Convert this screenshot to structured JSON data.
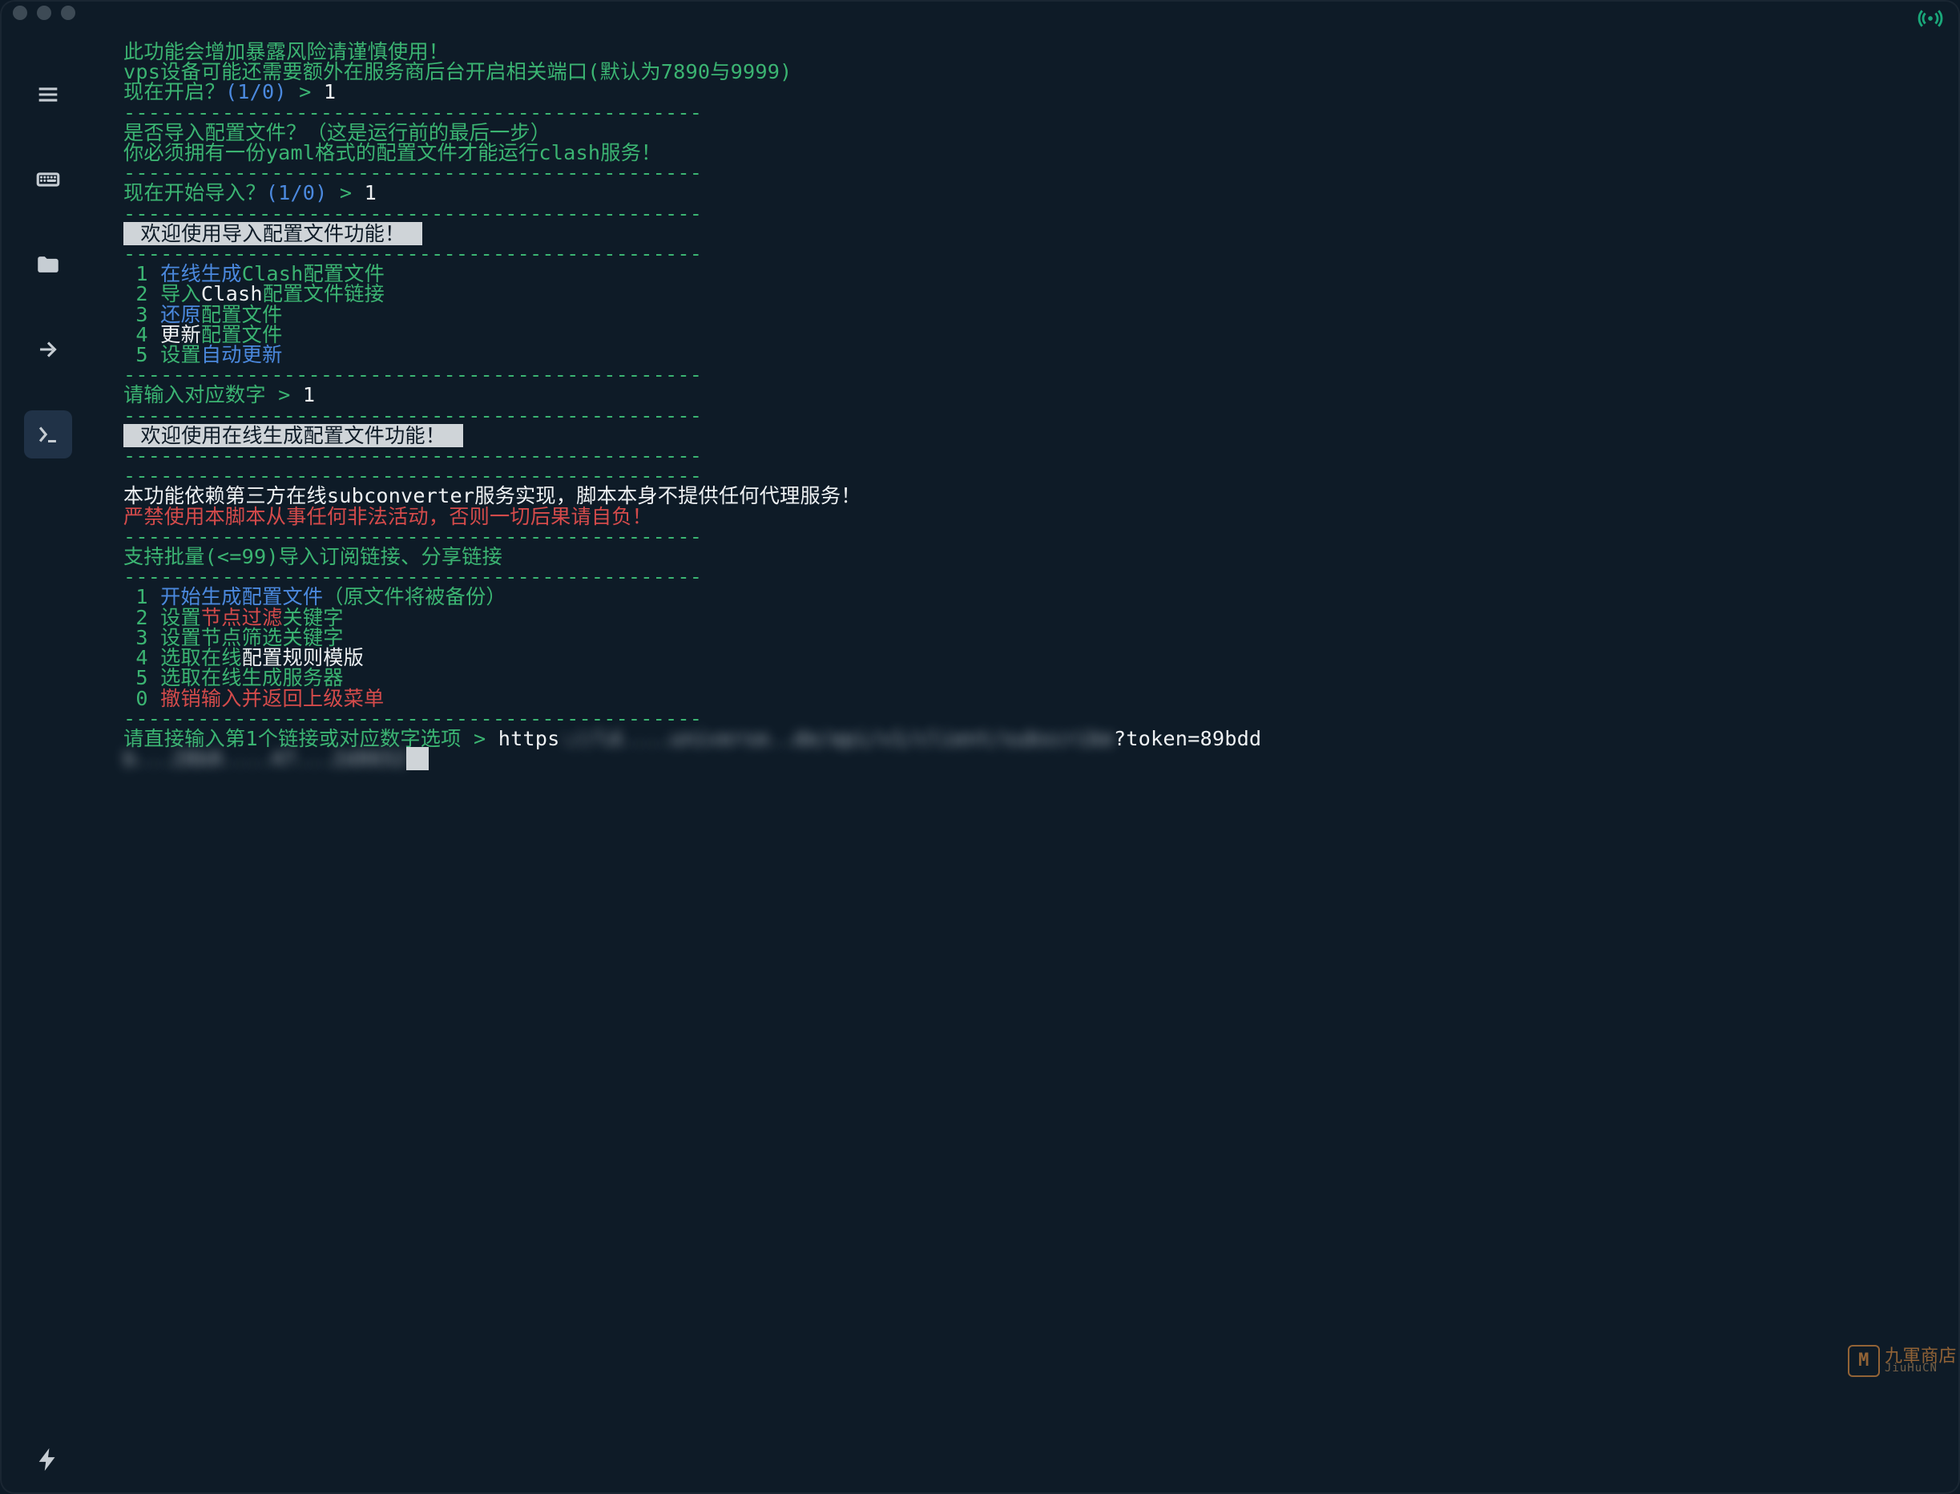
{
  "colors": {
    "bg": "#0e1b27",
    "green": "#3bb472",
    "blue": "#4b89de",
    "red": "#d44b4b",
    "white": "#eef1f3",
    "invert_bg": "#cfd4d8"
  },
  "sidebar": {
    "icons": [
      "menu-icon",
      "keyboard-icon",
      "folder-icon",
      "share-icon",
      "terminal-icon"
    ],
    "active": "terminal-icon",
    "bottom_icon": "bolt-icon"
  },
  "broadcast_icon": "broadcast-icon",
  "watermark": {
    "logo_letter": "M",
    "title": "九軍商店",
    "sub": "JiuHuCN"
  },
  "top": {
    "warn1": "此功能会增加暴露风险请谨慎使用！",
    "warn2_pre": "vps设备可能还需要额外在服务商后台开启相关端口",
    "warn2_ports": "(默认为7890与9999)",
    "open_now": "现在开启？",
    "yn": "(1/0)",
    "gt": ">",
    "answer1": "1"
  },
  "divider": "-----------------------------------------------",
  "import_cfg": {
    "q1": "是否导入配置文件？",
    "q1_note": "（这是运行前的最后一步）",
    "q2": "你必须拥有一份yaml格式的配置文件才能运行clash服务！",
    "start": "现在开始导入？",
    "yn": "(1/0)",
    "gt": ">",
    "answer": "1"
  },
  "menu1": {
    "banner": " 欢迎使用导入配置文件功能！ ",
    "items": [
      {
        "n": "1",
        "pre": "在线",
        "mid": "生成",
        "post": "Clash配置文件"
      },
      {
        "n": "2",
        "pre": "导入",
        "mid": "Clash",
        "post": "配置文件链接"
      },
      {
        "n": "3",
        "pre": "还原",
        "mid": "",
        "post": "配置文件"
      },
      {
        "n": "4",
        "pre": "更新",
        "mid": "",
        "post": "配置文件"
      },
      {
        "n": "5",
        "pre": "设置",
        "mid": "自动更新",
        "post": ""
      }
    ],
    "prompt": "请输入对应数字",
    "gt": ">",
    "answer": "1"
  },
  "menu2": {
    "banner": " 欢迎使用在线生成配置文件功能！ ",
    "note_white": "本功能依赖第三方在线subconverter服务实现，脚本本身不提供任何代理服务！",
    "note_red": "严禁使用本脚本从事任何非法活动，否则一切后果请自负！",
    "batch": "支持批量(<=99)导入订阅链接、分享链接",
    "items": [
      {
        "n": "1",
        "a": "开始",
        "b": "生成配置文件",
        "c": "（原文件将被备份）"
      },
      {
        "n": "2",
        "a": "设置",
        "b": "节点过滤",
        "c": "关键字"
      },
      {
        "n": "3",
        "a": "设置节点筛选关键字",
        "b": "",
        "c": ""
      },
      {
        "n": "4",
        "a": "选取在线",
        "b": "配置规则模版",
        "c": ""
      },
      {
        "n": "5",
        "a": "选取在线生成服务器",
        "b": "",
        "c": ""
      },
      {
        "n": "0",
        "a": "撤销",
        "b": "输入并返回上级菜单",
        "c": ""
      }
    ],
    "final_prompt": "请直接输入第1个链接或对应数字选项",
    "gt": ">",
    "url_visible_prefix": "https",
    "url_blur_mid": "://ld....universe..de/api/v1/client/subscribe",
    "url_visible_suffix": "?token=89bdd",
    "url_line2_blur": "b...28b0....47...2d0652"
  }
}
